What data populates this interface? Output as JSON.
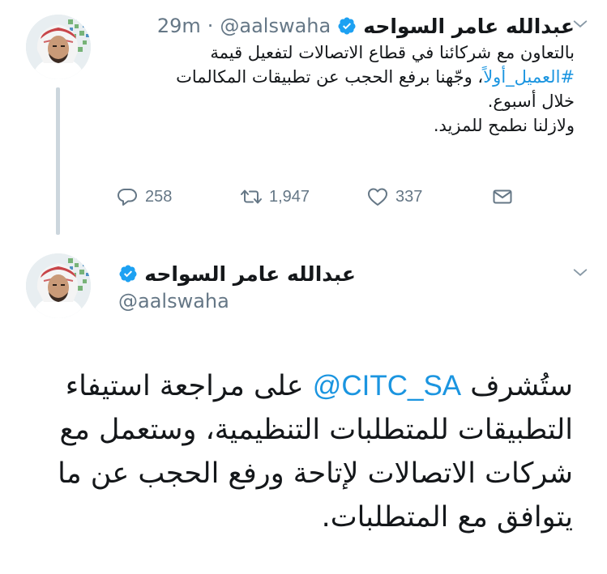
{
  "tweets": [
    {
      "author": {
        "display_name": "عبدالله عامر السواحه",
        "handle": "@aalswaha",
        "verified": true
      },
      "time": "29m",
      "separator": "·",
      "text_lines": [
        "بالتعاون مع شركائنا في قطاع الاتصالات لتفعيل قيمة",
        "وجّهنا برفع الحجب عن تطبيقات المكالمات",
        "خلال أسبوع.",
        "ولازلنا نطمح للمزيد."
      ],
      "hashtag": "#العميل_أولاً",
      "hashtag_suffix": "، ",
      "stats": {
        "replies": "258",
        "retweets": "1,947",
        "likes": "337"
      }
    },
    {
      "author": {
        "display_name": "عبدالله عامر السواحه",
        "handle": "@aalswaha",
        "verified": true
      },
      "text_lines": {
        "line1_before": "ستُشرف",
        "mention": "@CITC_SA",
        "line1_after": "على مراجعة استيفاء",
        "line2": "التطبيقات للمتطلبات التنظيمية، وستعمل مع",
        "line3": "شركات الاتصالات لإتاحة ورفع الحجب عن ما",
        "line4": "يتوافق مع المتطلبات."
      }
    }
  ],
  "icons": {
    "reply": "reply-icon",
    "retweet": "retweet-icon",
    "like": "heart-icon",
    "dm": "envelope-icon",
    "verified": "verified-badge-icon",
    "caret": "chevron-down-icon"
  },
  "colors": {
    "link": "#1b95e0",
    "verified": "#1da1f2",
    "muted": "#657786",
    "text": "#14171a"
  }
}
